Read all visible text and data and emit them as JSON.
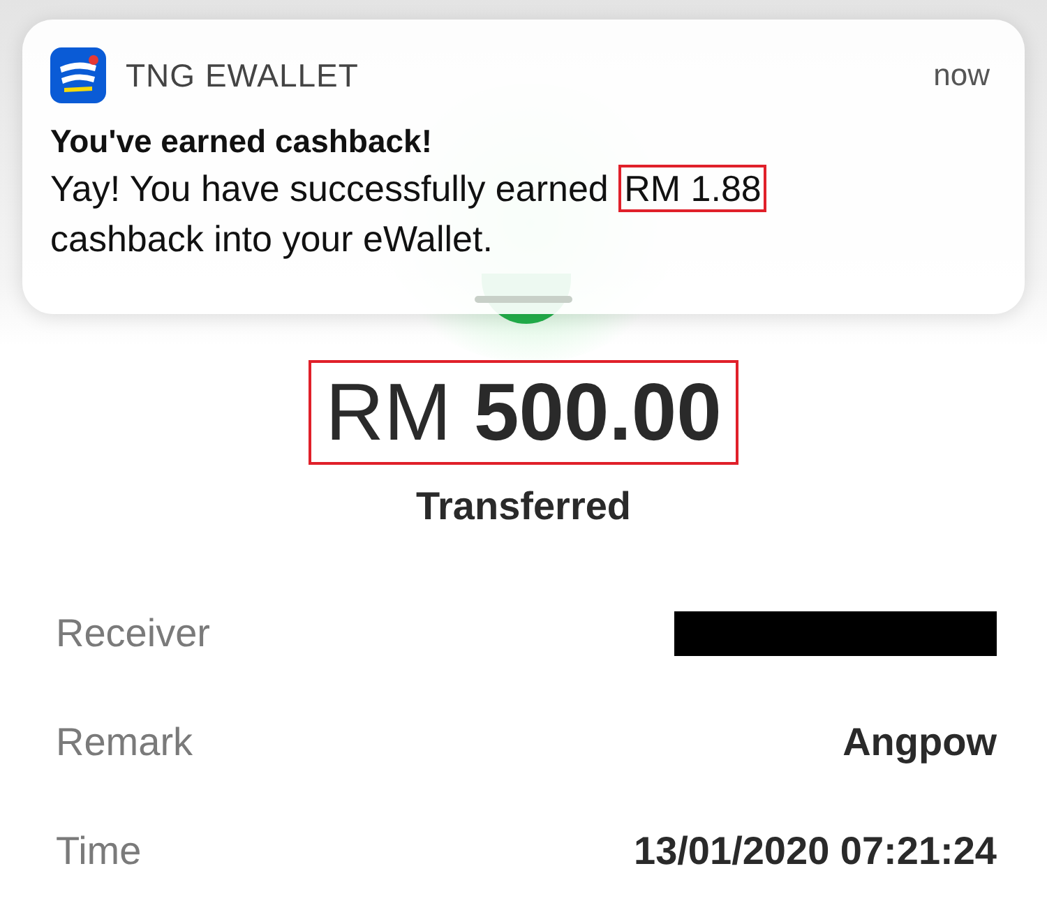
{
  "notification": {
    "app_name": "TNG EWALLET",
    "time": "now",
    "title": "You've earned cashback!",
    "body": {
      "before": "Yay! You have successfully earned",
      "highlight": "RM 1.88",
      "after": "cashback into your eWallet.",
      "highlighted": true
    }
  },
  "amount": {
    "currency": "RM",
    "value": "500.00",
    "highlighted": true
  },
  "status": "Transferred",
  "details": [
    {
      "label": "Receiver",
      "redacted": true
    },
    {
      "label": "Remark",
      "value": "Angpow",
      "redacted": false
    },
    {
      "label": "Time",
      "value": "13/01/2020 07:21:24",
      "redacted": false
    }
  ]
}
